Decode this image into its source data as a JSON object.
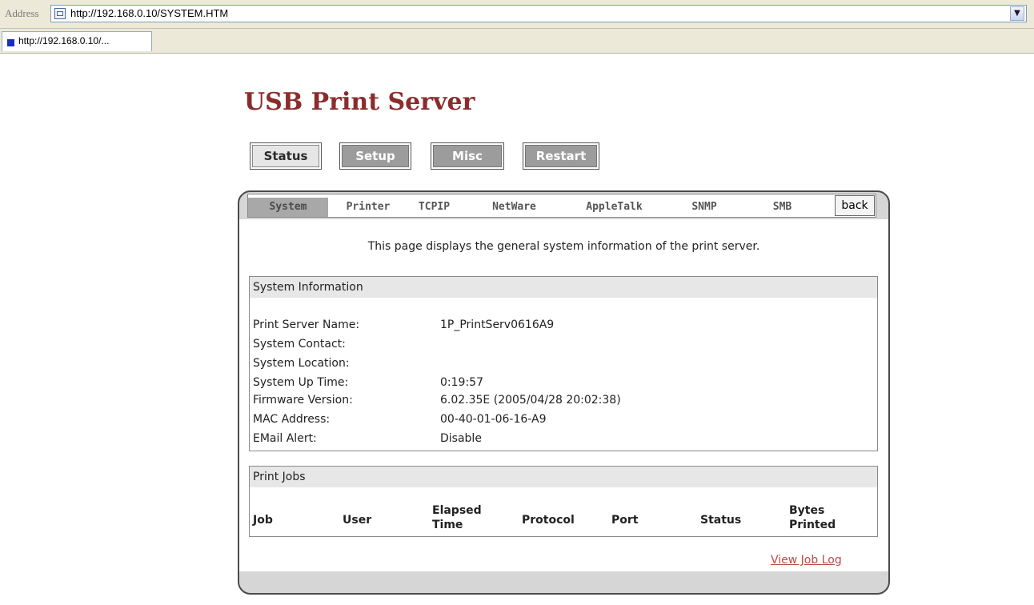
{
  "browser": {
    "address_label": "Address",
    "url": "http://192.168.0.10/SYSTEM.HTM",
    "tab_title": "http://192.168.0.10/..."
  },
  "page": {
    "title": "USB Print Server",
    "top_nav": [
      {
        "label": "Status",
        "active": true
      },
      {
        "label": "Setup",
        "active": false
      },
      {
        "label": "Misc",
        "active": false
      },
      {
        "label": "Restart",
        "active": false
      }
    ],
    "sub_nav": [
      {
        "label": "System",
        "active": true
      },
      {
        "label": "Printer",
        "active": false
      },
      {
        "label": "TCPIP",
        "active": false
      },
      {
        "label": "NetWare",
        "active": false
      },
      {
        "label": "AppleTalk",
        "active": false
      },
      {
        "label": "SNMP",
        "active": false
      },
      {
        "label": "SMB",
        "active": false
      }
    ],
    "back_label": "back",
    "intro": "This page displays the general system information of the print server.",
    "system_info": {
      "heading": "System Information",
      "rows": [
        {
          "label": "Print Server Name:",
          "value": "1P_PrintServ0616A9"
        },
        {
          "label": "System Contact:",
          "value": ""
        },
        {
          "label": "System Location:",
          "value": ""
        },
        {
          "label": "System Up Time:",
          "value": "0:19:57"
        },
        {
          "label": "Firmware Version:",
          "value": "6.02.35E (2005/04/28 20:02:38)"
        },
        {
          "label": "MAC Address:",
          "value": "00-40-01-06-16-A9"
        },
        {
          "label": "EMail Alert:",
          "value": "Disable"
        }
      ]
    },
    "print_jobs": {
      "heading": "Print Jobs",
      "columns": [
        "Job",
        "User",
        "Elapsed Time",
        "Protocol",
        "Port",
        "Status",
        "Bytes Printed"
      ]
    },
    "view_job_log": "View Job Log"
  },
  "colors": {
    "title": "#8b2c2c",
    "link": "#b84a4a",
    "panel_bg": "#d6d6d6",
    "inactive_button": "#9c9c9c"
  },
  "icons": [
    "page-icon",
    "dropdown-arrow-icon",
    "tab-favicon-icon"
  ]
}
